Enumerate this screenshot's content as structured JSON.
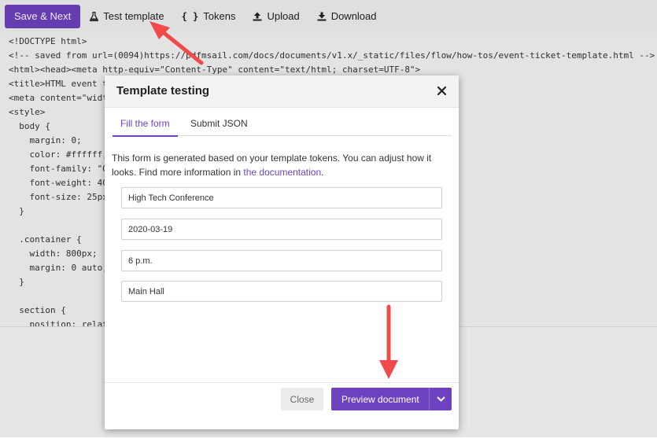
{
  "toolbar": {
    "save_next": "Save & Next",
    "test_template": "Test template",
    "tokens": "Tokens",
    "upload": "Upload",
    "download": "Download",
    "icons": {
      "test_template": "flask-icon",
      "tokens": "code-braces-icon",
      "upload": "upload-icon",
      "download": "download-icon"
    }
  },
  "editor": {
    "lines": [
      "<!DOCTYPE html>",
      "<!-- saved from url=(0094)https://pdfmsail.com/docs/documents/v1.x/_static/files/flow/how-tos/event-ticket-template.html -->",
      "<html><head><meta http-equiv=\"Content-Type\" content=\"text/html; charset=UTF-8\">",
      "<title>HTML event t",
      "<meta content=\"widt",
      "<style>",
      "  body {",
      "    margin: 0;",
      "    color: #ffffff;",
      "    font-family: \"O",
      "    font-weight: 40",
      "    font-size: 25px",
      "  }",
      "",
      "  .container {",
      "    width: 800px;",
      "    margin: 0 auto;",
      "  }",
      "",
      "  section {",
      "    position: relat"
    ]
  },
  "modal": {
    "title": "Template testing",
    "close_icon": "close-icon",
    "tabs": [
      {
        "label": "Fill the form",
        "active": true
      },
      {
        "label": "Submit JSON",
        "active": false
      }
    ],
    "description_prefix": "This form is generated based on your template tokens. You can adjust how it looks. Find more information in ",
    "description_link": "the documentation",
    "description_suffix": ".",
    "fields": [
      {
        "value": "High Tech Conference"
      },
      {
        "value": "2020-03-19"
      },
      {
        "value": "6 p.m."
      },
      {
        "value": "Main Hall"
      }
    ],
    "close_button": "Close",
    "preview_button": "Preview document",
    "preview_dropdown_icon": "chevron-down-icon"
  },
  "colors": {
    "accent": "#6f42c1",
    "annotation_arrow": "#f04a4a"
  }
}
